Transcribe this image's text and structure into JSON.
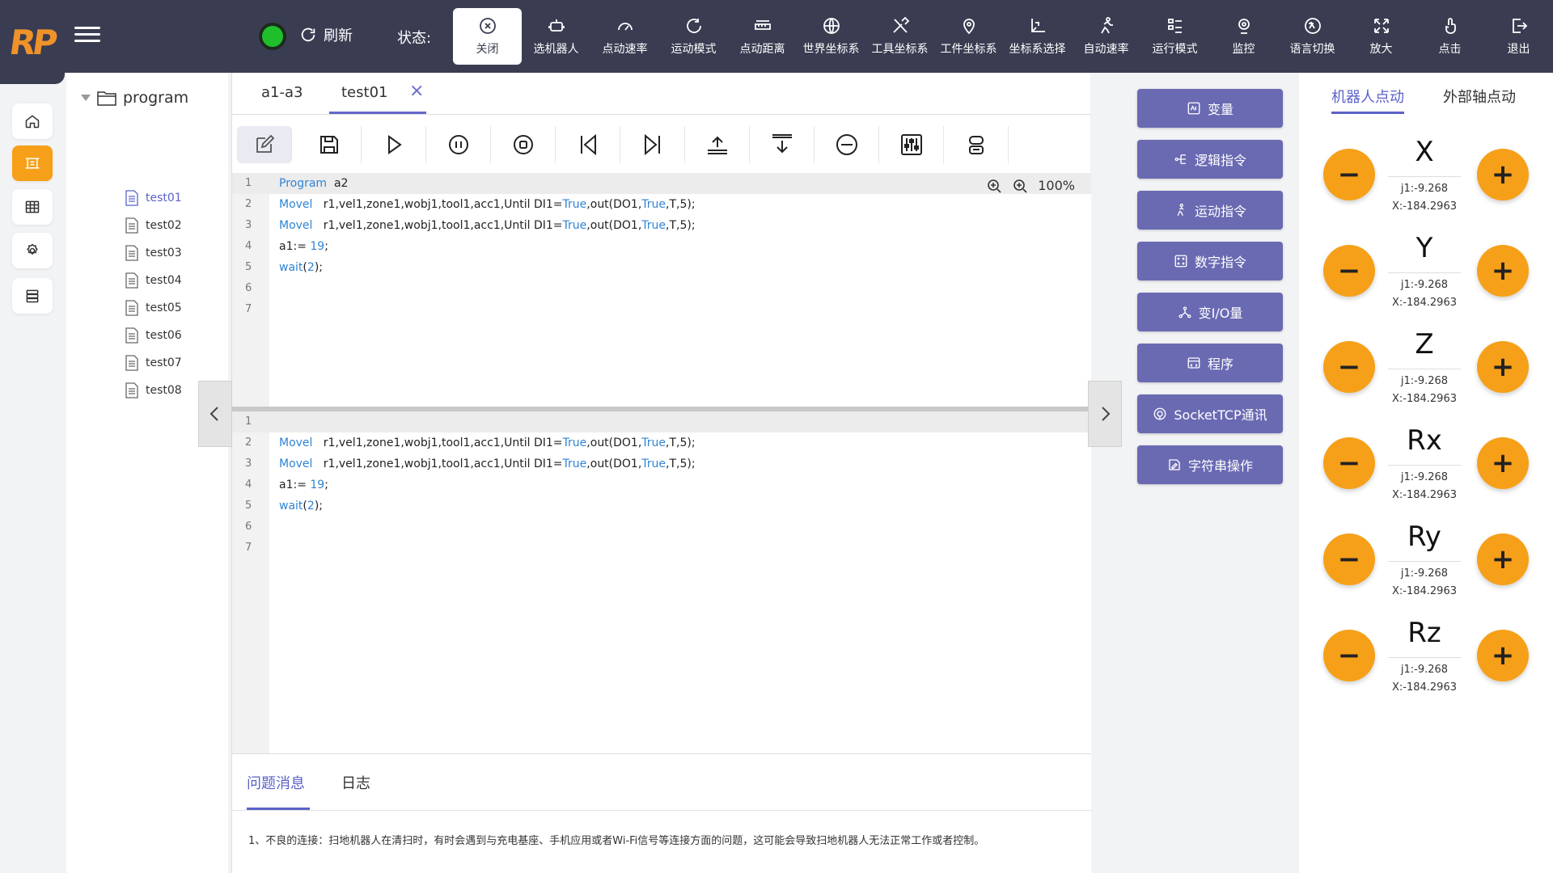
{
  "header": {
    "logo": "RP",
    "refresh_label": "刷新",
    "status_label": "状态:",
    "tools": [
      {
        "label": "关闭",
        "icon": "close-circle-icon"
      },
      {
        "label": "选机器人",
        "icon": "robot-icon"
      },
      {
        "label": "点动速率",
        "icon": "speedometer-icon"
      },
      {
        "label": "运动模式",
        "icon": "loop-icon"
      },
      {
        "label": "点动距离",
        "icon": "ruler-icon"
      },
      {
        "label": "世界坐标系",
        "icon": "globe-icon"
      },
      {
        "label": "工具坐标系",
        "icon": "tools-icon"
      },
      {
        "label": "工件坐标系",
        "icon": "location-pin-icon"
      },
      {
        "label": "坐标系选择",
        "icon": "axis-icon"
      },
      {
        "label": "自动速率",
        "icon": "running-icon"
      },
      {
        "label": "运行模式",
        "icon": "list-icon"
      },
      {
        "label": "监控",
        "icon": "camera-icon"
      },
      {
        "label": "语言切换",
        "icon": "language-icon"
      },
      {
        "label": "放大",
        "icon": "expand-icon"
      },
      {
        "label": "点击",
        "icon": "tap-icon"
      },
      {
        "label": "退出",
        "icon": "logout-icon"
      }
    ]
  },
  "tree": {
    "root": "program",
    "items": [
      "test01",
      "test02",
      "test03",
      "test04",
      "test05",
      "test06",
      "test07",
      "test08"
    ],
    "selected": "test01"
  },
  "editor": {
    "tabs": [
      "a1-a3",
      "test01"
    ],
    "zoom": "100%",
    "pane1": [
      {
        "n": "1",
        "parts": [
          [
            "kw",
            "Program"
          ],
          [
            "",
            "  a2"
          ]
        ]
      },
      {
        "n": "2",
        "parts": [
          [
            "kw",
            "Movel"
          ],
          [
            "",
            "   r1,vel1,zone1,wobj1,tool1,acc1,Until DI1="
          ],
          [
            "kw",
            "True"
          ],
          [
            "",
            ",out(DO1,"
          ],
          [
            "kw",
            "True"
          ],
          [
            "",
            ",T,5);"
          ]
        ]
      },
      {
        "n": "3",
        "parts": [
          [
            "kw",
            "Movel"
          ],
          [
            "",
            "   r1,vel1,zone1,wobj1,tool1,acc1,Until DI1="
          ],
          [
            "kw",
            "True"
          ],
          [
            "",
            ",out(DO1,"
          ],
          [
            "kw",
            "True"
          ],
          [
            "",
            ",T,5);"
          ]
        ]
      },
      {
        "n": "4",
        "parts": [
          [
            "",
            "a1:= "
          ],
          [
            "kw",
            "19"
          ],
          [
            "",
            ";"
          ]
        ]
      },
      {
        "n": "5",
        "parts": [
          [
            "kw",
            "wait"
          ],
          [
            "",
            "("
          ],
          [
            "kw",
            "2"
          ],
          [
            "",
            ");"
          ]
        ]
      },
      {
        "n": "6",
        "parts": []
      },
      {
        "n": "7",
        "parts": []
      }
    ],
    "pane2": [
      {
        "n": "1",
        "parts": []
      },
      {
        "n": "2",
        "parts": [
          [
            "kw",
            "Movel"
          ],
          [
            "",
            "   r1,vel1,zone1,wobj1,tool1,acc1,Until DI1="
          ],
          [
            "kw",
            "True"
          ],
          [
            "",
            ",out(DO1,"
          ],
          [
            "kw",
            "True"
          ],
          [
            "",
            ",T,5);"
          ]
        ]
      },
      {
        "n": "3",
        "parts": [
          [
            "kw",
            "Movel"
          ],
          [
            "",
            "   r1,vel1,zone1,wobj1,tool1,acc1,Until DI1="
          ],
          [
            "kw",
            "True"
          ],
          [
            "",
            ",out(DO1,"
          ],
          [
            "kw",
            "True"
          ],
          [
            "",
            ",T,5);"
          ]
        ]
      },
      {
        "n": "4",
        "parts": [
          [
            "",
            "a1:= "
          ],
          [
            "kw",
            "19"
          ],
          [
            "",
            ";"
          ]
        ]
      },
      {
        "n": "5",
        "parts": [
          [
            "kw",
            "wait"
          ],
          [
            "",
            "("
          ],
          [
            "kw",
            "2"
          ],
          [
            "",
            ");"
          ]
        ]
      },
      {
        "n": "6",
        "parts": []
      },
      {
        "n": "7",
        "parts": []
      }
    ]
  },
  "messages": {
    "tabs": [
      "问题消息",
      "日志"
    ],
    "text": "1、不良的连接：扫地机器人在清扫时，有时会遇到与充电基座、手机应用或者Wi-Fi信号等连接方面的问题，这可能会导致扫地机器人无法正常工作或者控制。"
  },
  "instructions": [
    {
      "label": "变量",
      "icon": "variable-icon"
    },
    {
      "label": "逻辑指令",
      "icon": "logic-icon"
    },
    {
      "label": "运动指令",
      "icon": "motion-icon"
    },
    {
      "label": "数字指令",
      "icon": "digital-icon"
    },
    {
      "label": "变I/O量",
      "icon": "io-icon"
    },
    {
      "label": "程序",
      "icon": "program-icon"
    },
    {
      "label": "SocketTCP通讯",
      "icon": "socket-icon"
    },
    {
      "label": "字符串操作",
      "icon": "string-icon"
    }
  ],
  "jog": {
    "tabs": [
      "机器人点动",
      "外部轴点动"
    ],
    "axes": [
      {
        "name": "X",
        "j": "j1:-9.268",
        "x": "X:-184.2963"
      },
      {
        "name": "Y",
        "j": "j1:-9.268",
        "x": "X:-184.2963"
      },
      {
        "name": "Z",
        "j": "j1:-9.268",
        "x": "X:-184.2963"
      },
      {
        "name": "Rx",
        "j": "j1:-9.268",
        "x": "X:-184.2963"
      },
      {
        "name": "Ry",
        "j": "j1:-9.268",
        "x": "X:-184.2963"
      },
      {
        "name": "Rz",
        "j": "j1:-9.268",
        "x": "X:-184.2963"
      }
    ],
    "minus": "−",
    "plus": "+"
  },
  "colors": {
    "accent": "#6a6ab3",
    "orange": "#f6a019",
    "header": "#3a3d52",
    "keyword": "#2f84d4"
  }
}
